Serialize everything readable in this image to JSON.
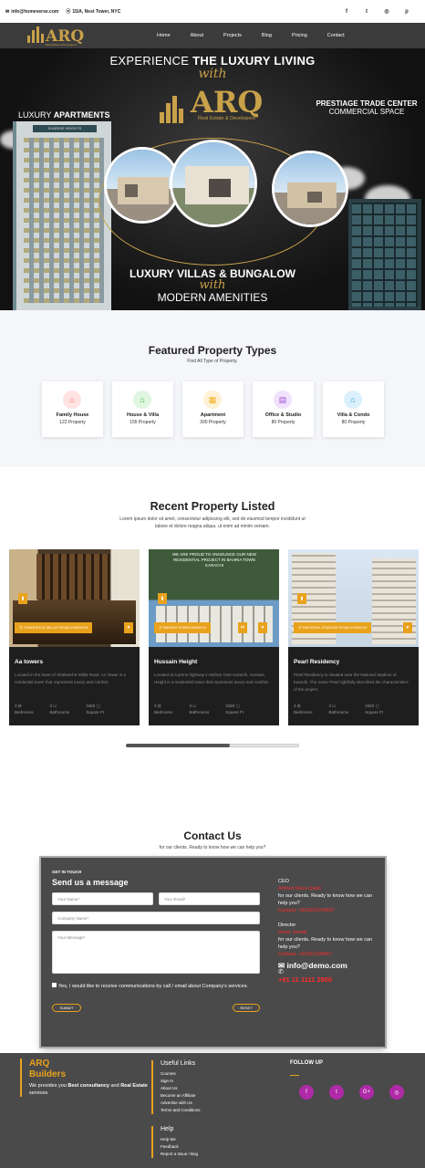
{
  "topbar": {
    "email": "info@homeverse.com",
    "address": "15/A, Nest Tower, NYC",
    "social_icons": [
      "facebook-icon",
      "twitter-icon",
      "instagram-icon",
      "pinterest-icon"
    ]
  },
  "nav": {
    "logo_word": "ARQ",
    "logo_sub": "Real Estate & Developers",
    "items": [
      "Home",
      "About",
      "Projects",
      "Blog",
      "Pricing",
      "Contact"
    ]
  },
  "hero": {
    "line1_light": "EXPERIENCE ",
    "line1_bold": "THE LUXURY LIVING",
    "with": "with",
    "logo_word": "ARQ",
    "logo_sub": "Real Estate & Developers",
    "apartments_light": "LUXURY ",
    "apartments_bold": "APARTMENTS",
    "building_sign": "SUNRISE HEIGHTS",
    "trade_line1": "PRESTIAGE TRADE CENTER",
    "trade_line2": "COMMERCIAL SPACE",
    "bottom_line1": "LUXURY VILLAS & BUNGALOW",
    "bottom_with": "with",
    "bottom_line2": "MODERN AMENITIES"
  },
  "featured": {
    "title": "Featured Property Types",
    "subtitle": "Find All Type of Property.",
    "types": [
      {
        "name": "Family House",
        "count": "122 Property",
        "icon": "house-icon",
        "color": "#ff6b6b",
        "bg": "#ffe3e3"
      },
      {
        "name": "House & Villa",
        "count": "155 Property",
        "icon": "villa-icon",
        "color": "#3cb043",
        "bg": "#e0f6e0"
      },
      {
        "name": "Apartment",
        "count": "300 Property",
        "icon": "apartment-icon",
        "color": "#f0b020",
        "bg": "#fdf1d6"
      },
      {
        "name": "Office & Studio",
        "count": "80 Property",
        "icon": "office-icon",
        "color": "#a14fd6",
        "bg": "#f1e2fb"
      },
      {
        "name": "Villa & Condo",
        "count": "80 Property",
        "icon": "condo-icon",
        "color": "#1e9bd7",
        "bg": "#dcf0fb"
      }
    ]
  },
  "recent": {
    "title": "Recent Property Listed",
    "subtitle_1": "Lorem ipsum dolor sit amet, consectetur adipiscing elit, sed do eiusmod tempor incididunt ut",
    "subtitle_2": "labore et dolore magna aliqua. ut enim ad minim veniam.",
    "cards": [
      {
        "tag": "SHAHEED-E-MILLAT ROAD,KARACHI",
        "title": "Aa towers",
        "desc": "Located in the heart of Shaheed-E-Millat Road, AA Tower is a residential tower that represents luxury and comfort.",
        "beds": "3",
        "baths": "3",
        "area": "3450",
        "bed_label": "Bedrooms",
        "bath_label": "Bathrooms",
        "area_label": "Square Ft",
        "banner": ""
      },
      {
        "tag": "BAHRIA TOWN,KARACHI",
        "title": "Hussain Height",
        "desc": "Located at a prime highway in Bahria Town Karachi, Hussain Height is a residential tower that represents luxury and comfort.",
        "beds": "3",
        "baths": "3",
        "area": "3450",
        "bed_label": "Bedrooms",
        "bath_label": "Bathrooms",
        "area_label": "Square Ft",
        "banner": "WE ARE PROUD TO ANNOUNCE OUR NEW RESIDENTIAL PROJECT IN BAHRIA TOWN KARACHI"
      },
      {
        "tag": "NATIONAL STADIUM ROAD,KARACHI",
        "title": "Pearl Residency",
        "desc": "Pearl Residency is situated near the National Stadium of Karachi. The name Pearl rightfully describes the characteristics of the project.",
        "beds": "3",
        "baths": "3",
        "area": "3450",
        "bed_label": "Bedrooms",
        "bath_label": "Bathrooms",
        "area_label": "Square Ft",
        "banner": ""
      }
    ],
    "slider_progress": 0.6
  },
  "contact": {
    "title": "Contact Us",
    "subtitle": "for our clients. Ready to know how we can help you?",
    "get_in_touch": "GET IN TOUCH",
    "send_message": "Send us a message",
    "name_placeholder": "Your Name*",
    "email_placeholder": "Your Email*",
    "company_placeholder": "Company Name*",
    "message_placeholder": "Your Message*",
    "consent": "Yes, I would like to receive communications by call / email about Company's services.",
    "submit_label": "SUBMIT",
    "reset_label": "RESET",
    "ceo_role": "CEO",
    "ceo_name": "Ahmed Raza Qadri",
    "ceo_text": "for our clients. Ready to know how we can help you?",
    "ceo_contact": "Contact: +923001234567",
    "director_role": "Director",
    "director_name": "Omer Junaid",
    "director_text": "for our clients. Ready to know how we can help you?",
    "director_contact": "Contact: +92301234567",
    "email": "info@demo.com",
    "phone": "+91 11 1111 2900"
  },
  "footer": {
    "brand_1": "ARQ",
    "brand_2": "Builders",
    "brand_desc_a": "We provides you ",
    "brand_desc_b": "Best consultancy",
    "brand_desc_c": " and ",
    "brand_desc_d": "Real Estate",
    "brand_desc_e": " services.",
    "useful_title": "Useful Links",
    "useful_links": [
      "Courses",
      "Sign In",
      "About Us",
      "Become an Affiliate",
      "Advertise with Us",
      "Terms and Conditions"
    ],
    "help_title": "Help",
    "help_links": [
      "Help Me",
      "Feedback",
      "Report a Issue / Bug"
    ],
    "follow_title": "FOLLOW UP",
    "social_icons": [
      "facebook-icon",
      "twitter-icon",
      "google-plus-icon",
      "instagram-icon"
    ]
  }
}
